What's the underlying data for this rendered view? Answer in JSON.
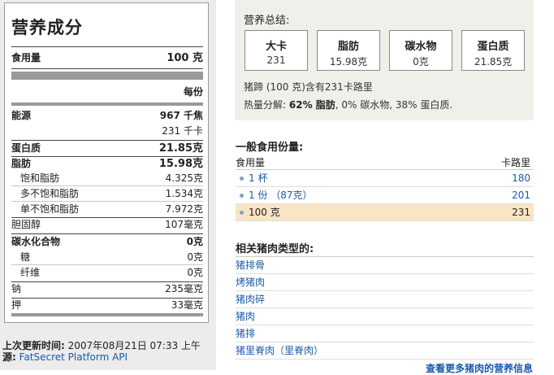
{
  "facts": {
    "title": "营养成分",
    "serving_label": "食用量",
    "serving_value": "100 克",
    "per_label": "每份",
    "energy_label": "能源",
    "energy_kj": "967 千焦",
    "energy_kcal": "231 千卡",
    "protein_label": "蛋白质",
    "protein_value": "21.85克",
    "fat_label": "脂肪",
    "fat_value": "15.98克",
    "sat_label": "饱和脂肪",
    "sat_value": "4.325克",
    "poly_label": "多不饱和脂肪",
    "poly_value": "1.534克",
    "mono_label": "单不饱和脂肪",
    "mono_value": "7.972克",
    "chol_label": "胆固醇",
    "chol_value": "107毫克",
    "carb_label": "碳水化合物",
    "carb_value": "0克",
    "sugar_label": "糖",
    "sugar_value": "0克",
    "fiber_label": "纤维",
    "fiber_value": "0克",
    "sodium_label": "钠",
    "sodium_value": "235毫克",
    "potassium_label": "押",
    "potassium_value": "33毫克"
  },
  "footer": {
    "updated_label": "上次更新时间:",
    "updated_value": " 2007年08月21日 07:33 上午",
    "source_label": "源:",
    "source_link": "FatSecret Platform API"
  },
  "summary": {
    "title": "营养总结:",
    "boxes": [
      {
        "label": "大卡",
        "value": "231"
      },
      {
        "label": "脂肪",
        "value": "15.98克"
      },
      {
        "label": "碳水物",
        "value": "0克"
      },
      {
        "label": "蛋白质",
        "value": "21.85克"
      }
    ],
    "line1": "猪蹄 (100 克)含有231卡路里",
    "breakdown_label": "热量分解:",
    "fat_pct": "62% 脂肪",
    "rest": ", 0% 碳水物, 38% 蛋白质."
  },
  "servings": {
    "title": "一般食用份量:",
    "col_amount": "食用量",
    "col_cal": "卡路里",
    "rows": [
      {
        "amount": "1 杯",
        "cal": "180"
      },
      {
        "amount": "1 份 （87克）",
        "cal": "201"
      },
      {
        "amount": "100 克",
        "cal": "231"
      }
    ]
  },
  "related": {
    "title": "相关猪肉类型的:",
    "items": [
      "猪排骨",
      "烤猪肉",
      "猪肉碎",
      "猪肉",
      "猪排",
      "猪里脊肉（里脊肉）"
    ],
    "more": "查看更多猪肉的营养信息"
  }
}
